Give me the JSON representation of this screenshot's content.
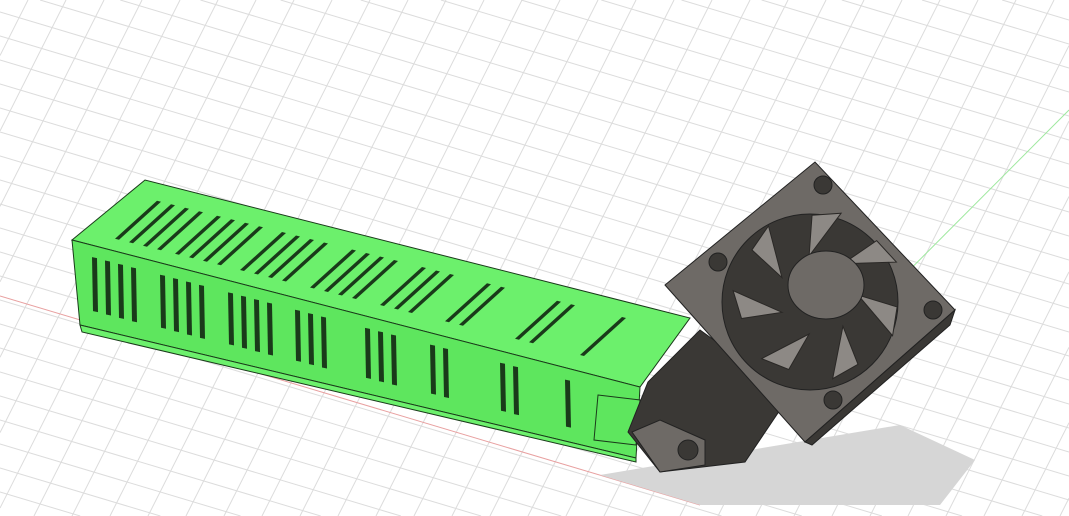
{
  "viewport": {
    "background": "#ffffff",
    "grid_color": "#dcdcdc",
    "x_axis_color": "#e8a0a0",
    "y_axis_color": "#9ee89e"
  },
  "model": {
    "duct_color": "#5ee65e",
    "duct_top_color": "#6cf06c",
    "duct_edge_color": "#1a3a1a",
    "fan_color": "#6e6a66",
    "fan_dark_color": "#3a3835",
    "shadow_color": "#d6d6d6"
  }
}
